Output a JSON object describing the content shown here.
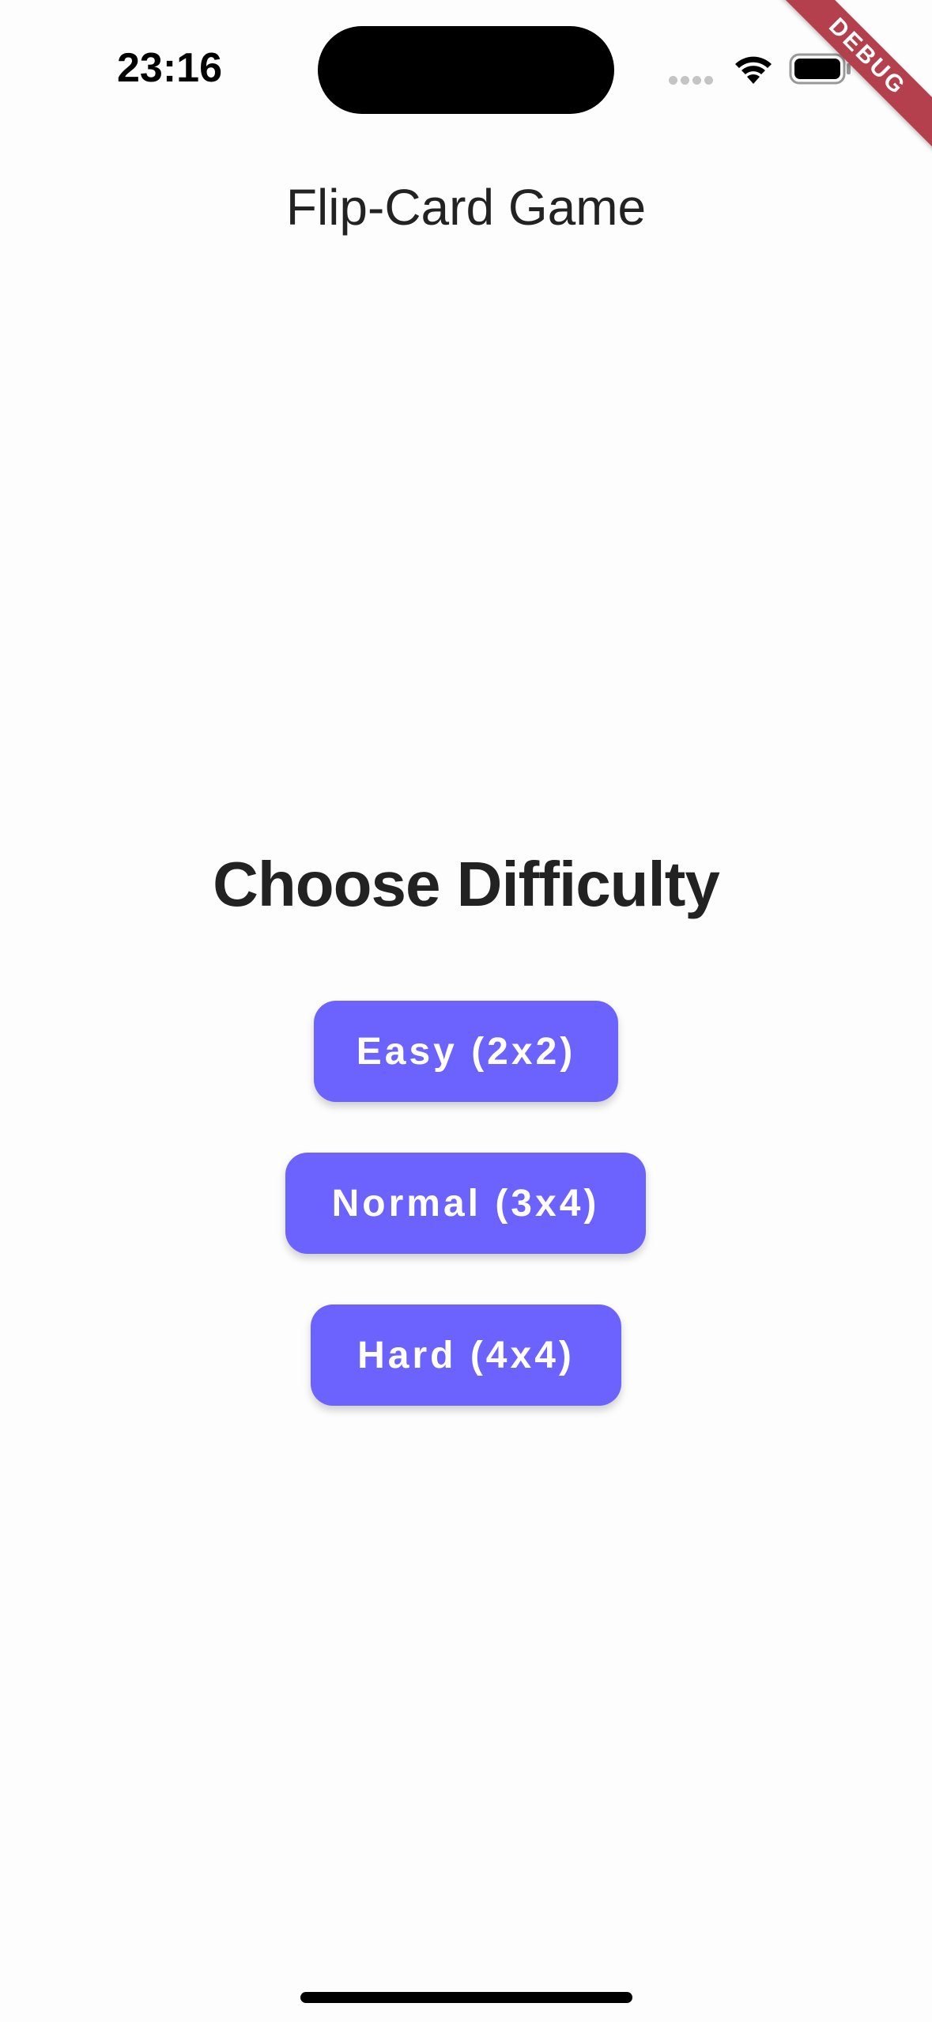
{
  "status_bar": {
    "time": "23:16",
    "wifi_icon": "wifi-icon",
    "battery_icon": "battery-icon"
  },
  "debug_banner": "DEBUG",
  "app_bar": {
    "title": "Flip-Card Game"
  },
  "main": {
    "heading": "Choose Difficulty",
    "buttons": [
      {
        "label": "Easy (2x2)"
      },
      {
        "label": "Normal (3x4)"
      },
      {
        "label": "Hard (4x4)"
      }
    ]
  },
  "colors": {
    "accent": "#6c63ff",
    "background": "#fdfdfd",
    "text": "#222222",
    "debug_ribbon": "#b5404d"
  }
}
